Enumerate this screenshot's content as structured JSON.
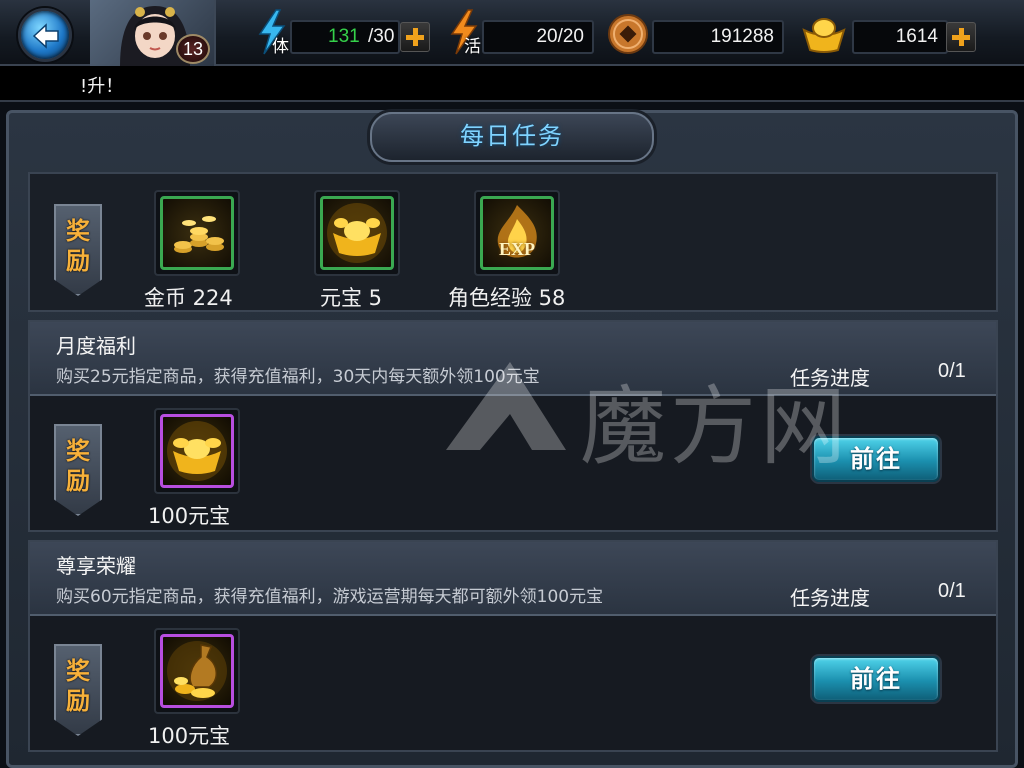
{
  "player": {
    "level": "13"
  },
  "resources": {
    "stamina": {
      "tag": "体",
      "current": "131",
      "max": "/30"
    },
    "energy": {
      "tag": "活",
      "value": "20/20"
    },
    "copper": {
      "value": "191288"
    },
    "gold": {
      "value": "1614"
    }
  },
  "notice": {
    "text": "!升！"
  },
  "page": {
    "title": "每日任务"
  },
  "reward_tag": {
    "line1": "奖",
    "line2": "励"
  },
  "daily_rewards": [
    {
      "icon": "gold-coins-icon",
      "label": "金币 224"
    },
    {
      "icon": "gold-ingot-icon",
      "label": "元宝 5"
    },
    {
      "icon": "exp-icon",
      "label": "角色经验 58",
      "badge": "EXP"
    }
  ],
  "tasks": [
    {
      "title": "月度福利",
      "desc": "购买25元指定商品，获得充值福利，30天内每天额外领100元宝",
      "progress_label": "任务进度",
      "progress": "0/1",
      "reward_label": "100元宝",
      "button_label": "前往"
    },
    {
      "title": "尊享荣耀",
      "desc": "购买60元指定商品，获得充值福利，游戏运营期每天都可额外领100元宝",
      "progress_label": "任务进度",
      "progress": "0/1",
      "reward_label": "100元宝",
      "button_label": "前往"
    }
  ],
  "watermark": {
    "text": "魔方网"
  },
  "colors": {
    "accent_blue": "#7fd3ff",
    "reward_gold": "#f7b13a",
    "stamina_green": "#35d14a",
    "button_teal": "#1b8fae"
  }
}
